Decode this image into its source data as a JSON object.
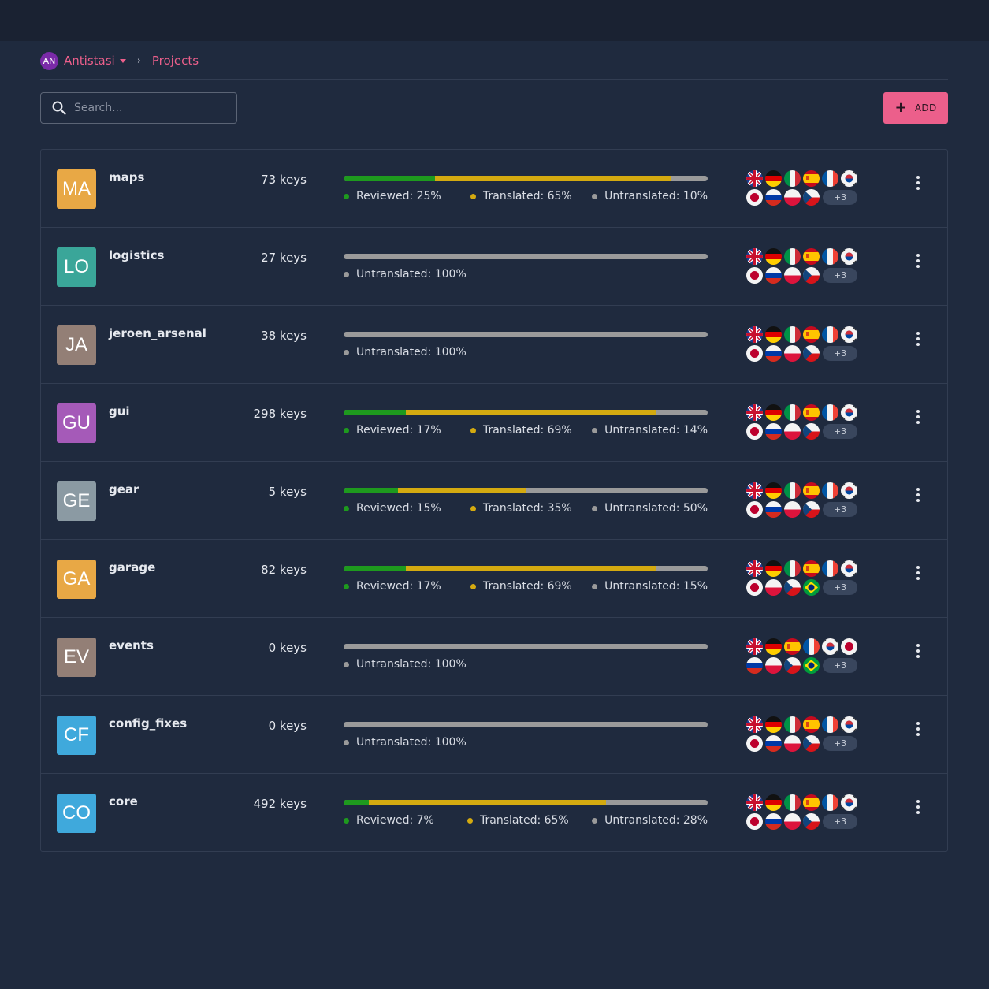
{
  "breadcrumb": {
    "org_initials": "AN",
    "org_name": "Antistasi",
    "separator": "›",
    "current": "Projects"
  },
  "search": {
    "placeholder": "Search..."
  },
  "add_button": {
    "label": "ADD"
  },
  "colors": {
    "reviewed": "#1e9a1e",
    "translated": "#d4aa10",
    "untranslated": "#9a9a9a",
    "accent": "#ec5f8b"
  },
  "projects": [
    {
      "initials": "MA",
      "name": "maps",
      "keys": "73 keys",
      "avatar_color": "#e8a845",
      "reviewed": 25,
      "translated": 65,
      "untranslated": 10,
      "labels": {
        "reviewed": "Reviewed: 25%",
        "translated": "Translated: 65%",
        "untranslated": "Untranslated: 10%"
      },
      "flags": [
        "gb",
        "de",
        "it",
        "es",
        "fr",
        "kr",
        "jp",
        "ru",
        "pl",
        "cz"
      ],
      "more": "+3"
    },
    {
      "initials": "LO",
      "name": "logistics",
      "keys": "27 keys",
      "avatar_color": "#3aa699",
      "reviewed": 0,
      "translated": 0,
      "untranslated": 100,
      "labels": {
        "untranslated": "Untranslated: 100%"
      },
      "flags": [
        "gb",
        "de",
        "it",
        "es",
        "fr",
        "kr",
        "jp",
        "ru",
        "pl",
        "cz"
      ],
      "more": "+3"
    },
    {
      "initials": "JA",
      "name": "jeroen_arsenal",
      "keys": "38 keys",
      "avatar_color": "#937f76",
      "reviewed": 0,
      "translated": 0,
      "untranslated": 100,
      "labels": {
        "untranslated": "Untranslated: 100%"
      },
      "flags": [
        "gb",
        "de",
        "it",
        "es",
        "fr",
        "kr",
        "jp",
        "ru",
        "pl",
        "cz"
      ],
      "more": "+3"
    },
    {
      "initials": "GU",
      "name": "gui",
      "keys": "298 keys",
      "avatar_color": "#a55ab8",
      "reviewed": 17,
      "translated": 69,
      "untranslated": 14,
      "labels": {
        "reviewed": "Reviewed: 17%",
        "translated": "Translated: 69%",
        "untranslated": "Untranslated: 14%"
      },
      "flags": [
        "gb",
        "de",
        "it",
        "es",
        "fr",
        "kr",
        "jp",
        "ru",
        "pl",
        "cz"
      ],
      "more": "+3"
    },
    {
      "initials": "GE",
      "name": "gear",
      "keys": "5 keys",
      "avatar_color": "#8b9aa3",
      "reviewed": 15,
      "translated": 35,
      "untranslated": 50,
      "labels": {
        "reviewed": "Reviewed: 15%",
        "translated": "Translated: 35%",
        "untranslated": "Untranslated: 50%"
      },
      "flags": [
        "gb",
        "de",
        "it",
        "es",
        "fr",
        "kr",
        "jp",
        "ru",
        "pl",
        "cz"
      ],
      "more": "+3"
    },
    {
      "initials": "GA",
      "name": "garage",
      "keys": "82 keys",
      "avatar_color": "#e8a845",
      "reviewed": 17,
      "translated": 69,
      "untranslated": 15,
      "labels": {
        "reviewed": "Reviewed: 17%",
        "translated": "Translated: 69%",
        "untranslated": "Untranslated: 15%"
      },
      "flags": [
        "gb",
        "de",
        "it",
        "es",
        "fr",
        "kr",
        "jp",
        "pl",
        "cz",
        "br"
      ],
      "more": "+3"
    },
    {
      "initials": "EV",
      "name": "events",
      "keys": "0 keys",
      "avatar_color": "#937f76",
      "reviewed": 0,
      "translated": 0,
      "untranslated": 100,
      "labels": {
        "untranslated": "Untranslated: 100%"
      },
      "flags": [
        "gb",
        "de",
        "es",
        "fr",
        "kr",
        "jp",
        "ru",
        "pl",
        "cz",
        "br"
      ],
      "more": "+3"
    },
    {
      "initials": "CF",
      "name": "config_fixes",
      "keys": "0 keys",
      "avatar_color": "#3fa9dc",
      "reviewed": 0,
      "translated": 0,
      "untranslated": 100,
      "labels": {
        "untranslated": "Untranslated: 100%"
      },
      "flags": [
        "gb",
        "de",
        "it",
        "es",
        "fr",
        "kr",
        "jp",
        "ru",
        "pl",
        "cz"
      ],
      "more": "+3"
    },
    {
      "initials": "CO",
      "name": "core",
      "keys": "492 keys",
      "avatar_color": "#3fa9dc",
      "reviewed": 7,
      "translated": 65,
      "untranslated": 28,
      "labels": {
        "reviewed": "Reviewed: 7%",
        "translated": "Translated: 65%",
        "untranslated": "Untranslated: 28%"
      },
      "flags": [
        "gb",
        "de",
        "it",
        "es",
        "fr",
        "kr",
        "jp",
        "ru",
        "pl",
        "cz"
      ],
      "more": "+3"
    }
  ]
}
